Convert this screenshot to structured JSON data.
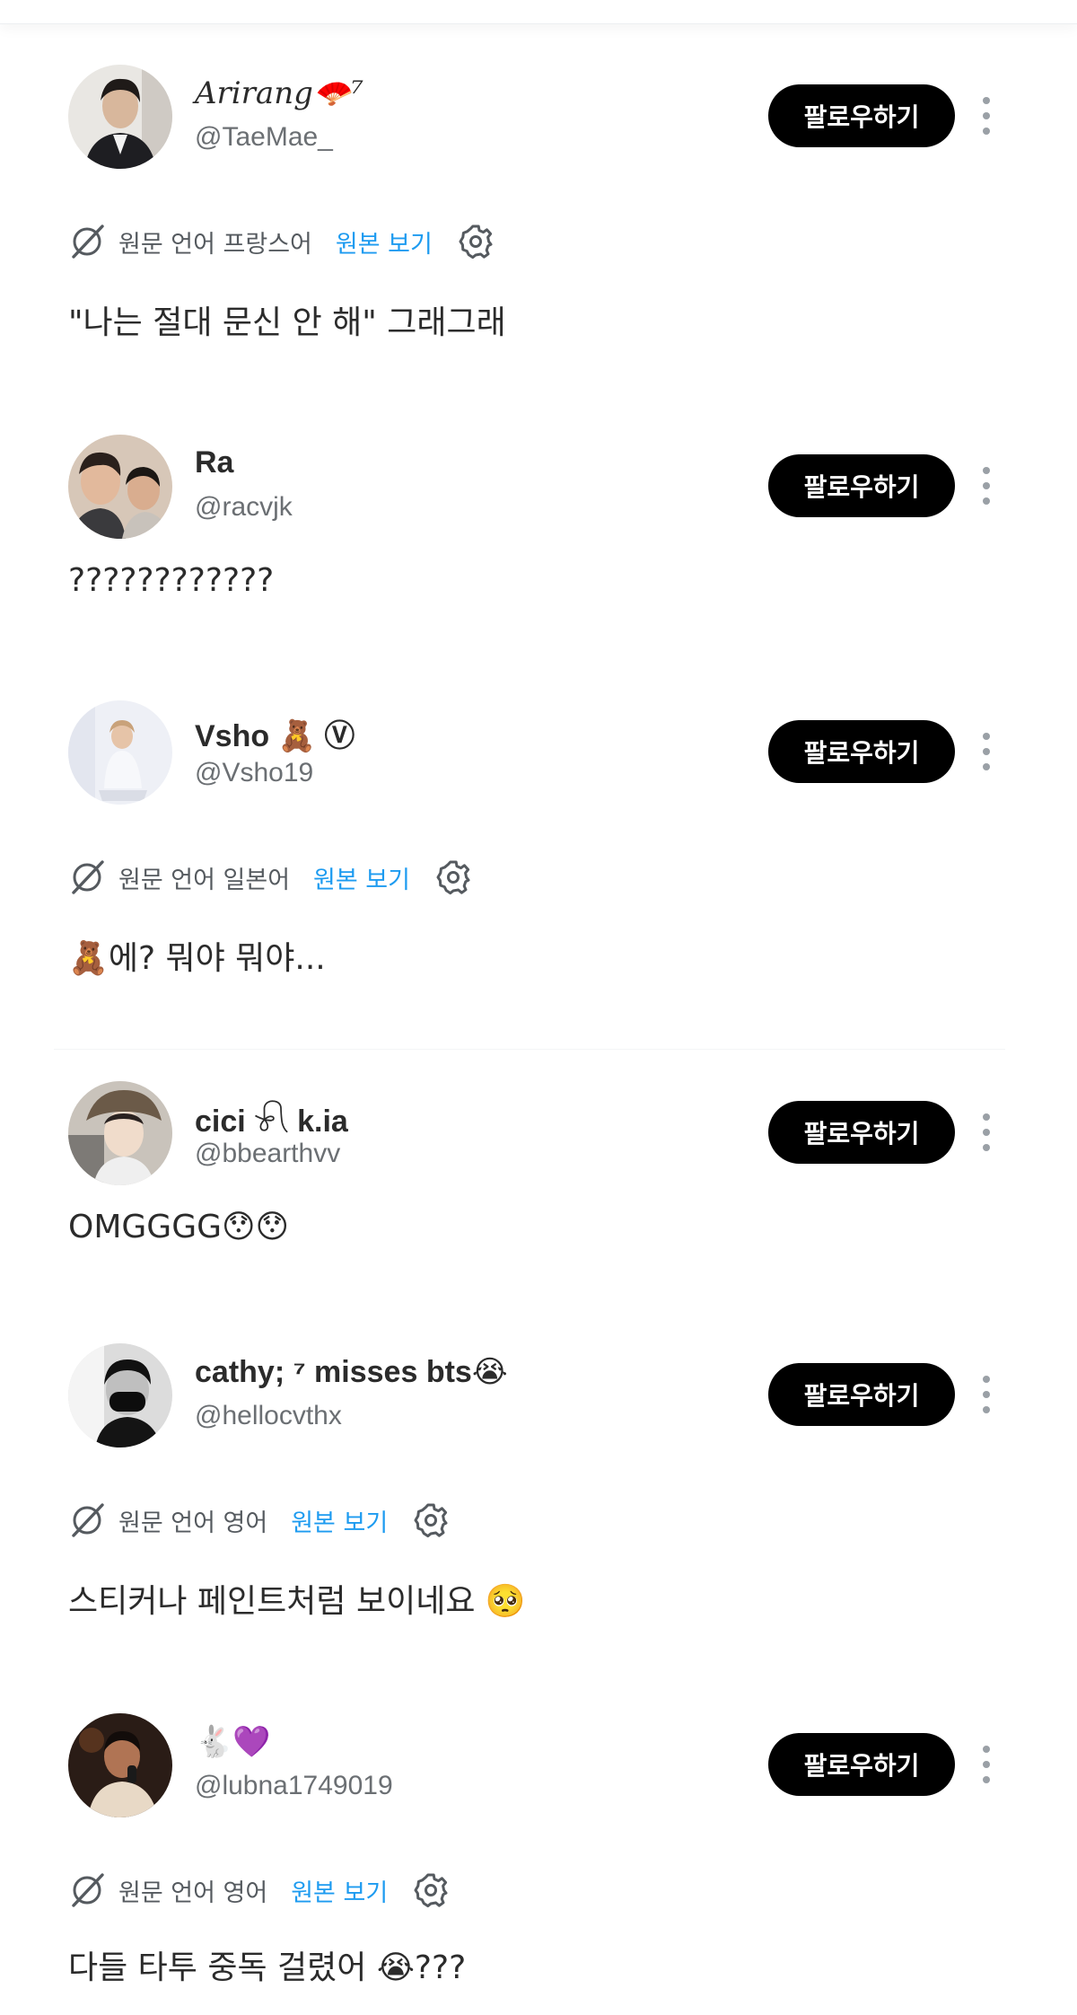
{
  "follow_label": "팔로우하기",
  "translation": {
    "original_link": "원본 보기"
  },
  "replies": [
    {
      "name": "Arirang🪭⁷",
      "handle": "@TaeMae_",
      "translation_label": "원문 언어 프랑스어",
      "text": "\"나는 절대 문신 안 해\" 그래그래"
    },
    {
      "name": "Ra",
      "handle": "@racvjk",
      "text": "????????????"
    },
    {
      "name": "Vsho 🧸 Ⓥ",
      "handle": "@Vsho19",
      "translation_label": "원문 언어 일본어",
      "text": "🧸에? 뭐야 뭐야..."
    },
    {
      "name": "cici 𓍯 k.ia",
      "handle": "@bbearthvv",
      "text": "OMGGGG😯😯"
    },
    {
      "name": "cathy; ⁷ misses bts😭",
      "handle": "@hellocvthx",
      "translation_label": "원문 언어 영어",
      "text": "스티커나 페인트처럼 보이네요 🥺"
    },
    {
      "name": "🐇💜",
      "handle": "@lubna1749019",
      "translation_label": "원문 언어 영어",
      "text": "다들 타투 중독 걸렸어 😭???"
    }
  ],
  "icons": {
    "translate": "globe-slash-icon",
    "settings": "gear-icon",
    "more": "more-vertical-icon"
  },
  "colors": {
    "link": "#1d9bf0",
    "button_bg": "#000000",
    "secondary_text": "#6b6f73"
  }
}
